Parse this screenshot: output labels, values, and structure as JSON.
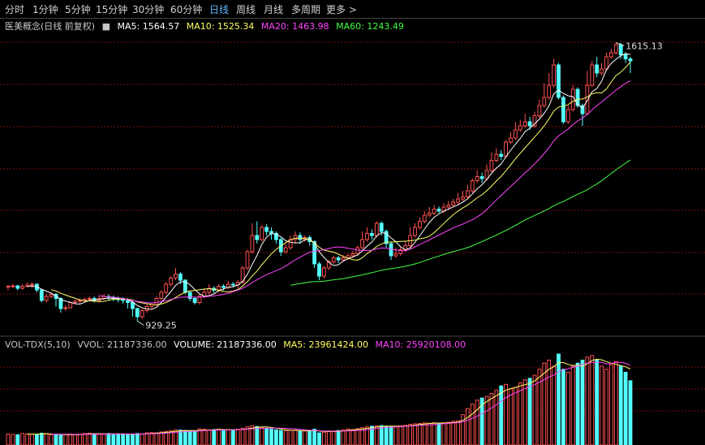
{
  "tabs": [
    "分时",
    "1分钟",
    "5分钟",
    "15分钟",
    "30分钟",
    "60分钟",
    "日线",
    "周线",
    "月线",
    "多周期",
    "更多 >"
  ],
  "active_tab": "日线",
  "header": {
    "name": "医美概念(日线 前复权)",
    "ma5": "MA5: 1564.57",
    "ma10": "MA10: 1525.34",
    "ma20": "MA20: 1463.98",
    "ma60": "MA60: 1243.49"
  },
  "vol_header": {
    "name": "VOL-TDX(5,10)",
    "vvol": "VVOL: 21187336.00",
    "volume": "VOLUME: 21187336.00",
    "ma5": "MA5: 23961424.00",
    "ma10": "MA10: 25920108.00"
  },
  "colors": {
    "up": "#ff5050",
    "down": "#54ffff",
    "ma5": "#ffffff",
    "ma10": "#ffff66",
    "ma20": "#ff44ff",
    "ma60": "#44ff44",
    "grid": "#7a1010",
    "text": "#c8c8c8",
    "active_tab": "#5fb8ff"
  },
  "chart_data": {
    "type": "candlestick",
    "annotations": {
      "high": "1615.13",
      "low": "929.25"
    },
    "price_range": [
      900,
      1640
    ],
    "volume_range": [
      0,
      30000000
    ],
    "candles": [
      [
        1013,
        1015,
        1005,
        1018
      ],
      [
        1015,
        1016,
        1010,
        1020
      ],
      [
        1016,
        1010,
        1005,
        1018
      ],
      [
        1010,
        1015,
        1006,
        1020
      ],
      [
        1015,
        1018,
        1012,
        1025
      ],
      [
        1018,
        1020,
        1010,
        1024
      ],
      [
        1020,
        1006,
        1000,
        1022
      ],
      [
        1006,
        980,
        975,
        1008
      ],
      [
        980,
        990,
        975,
        995
      ],
      [
        990,
        995,
        985,
        1000
      ],
      [
        995,
        985,
        965,
        998
      ],
      [
        985,
        960,
        950,
        988
      ],
      [
        960,
        962,
        955,
        968
      ],
      [
        962,
        975,
        960,
        978
      ],
      [
        975,
        978,
        970,
        982
      ],
      [
        978,
        980,
        973,
        985
      ],
      [
        980,
        983,
        975,
        987
      ],
      [
        983,
        985,
        978,
        990
      ],
      [
        985,
        980,
        975,
        990
      ],
      [
        980,
        985,
        975,
        992
      ],
      [
        985,
        990,
        980,
        995
      ],
      [
        990,
        988,
        980,
        995
      ],
      [
        988,
        985,
        978,
        992
      ],
      [
        985,
        982,
        975,
        990
      ],
      [
        982,
        980,
        972,
        988
      ],
      [
        980,
        975,
        960,
        985
      ],
      [
        975,
        960,
        940,
        978
      ],
      [
        960,
        940,
        929,
        962
      ],
      [
        940,
        955,
        935,
        958
      ],
      [
        955,
        965,
        950,
        970
      ],
      [
        965,
        970,
        960,
        975
      ],
      [
        970,
        985,
        965,
        990
      ],
      [
        985,
        1000,
        980,
        1005
      ],
      [
        1000,
        1020,
        995,
        1025
      ],
      [
        1020,
        1035,
        1015,
        1040
      ],
      [
        1035,
        1045,
        1030,
        1060
      ],
      [
        1045,
        1030,
        1020,
        1050
      ],
      [
        1030,
        1000,
        995,
        1032
      ],
      [
        1000,
        985,
        978,
        1002
      ],
      [
        985,
        975,
        970,
        988
      ],
      [
        975,
        990,
        970,
        995
      ],
      [
        990,
        1000,
        985,
        1010
      ],
      [
        1000,
        1010,
        995,
        1020
      ],
      [
        1010,
        1005,
        998,
        1015
      ],
      [
        1005,
        1015,
        1000,
        1020
      ],
      [
        1015,
        1012,
        1005,
        1020
      ],
      [
        1012,
        1020,
        1008,
        1028
      ],
      [
        1020,
        1018,
        1012,
        1025
      ],
      [
        1018,
        1025,
        1010,
        1030
      ],
      [
        1025,
        1060,
        1020,
        1065
      ],
      [
        1060,
        1100,
        1055,
        1105
      ],
      [
        1100,
        1140,
        1095,
        1170
      ],
      [
        1140,
        1130,
        1120,
        1175
      ],
      [
        1130,
        1160,
        1125,
        1165
      ],
      [
        1160,
        1150,
        1140,
        1168
      ],
      [
        1150,
        1145,
        1130,
        1160
      ],
      [
        1145,
        1130,
        1120,
        1150
      ],
      [
        1130,
        1100,
        1090,
        1135
      ],
      [
        1100,
        1110,
        1095,
        1120
      ],
      [
        1110,
        1130,
        1105,
        1140
      ],
      [
        1130,
        1140,
        1120,
        1150
      ],
      [
        1140,
        1130,
        1120,
        1148
      ],
      [
        1130,
        1135,
        1125,
        1140
      ],
      [
        1135,
        1125,
        1115,
        1140
      ],
      [
        1125,
        1070,
        1060,
        1128
      ],
      [
        1070,
        1040,
        1030,
        1075
      ],
      [
        1040,
        1060,
        1035,
        1065
      ],
      [
        1060,
        1075,
        1055,
        1080
      ],
      [
        1075,
        1085,
        1070,
        1090
      ],
      [
        1085,
        1080,
        1072,
        1090
      ],
      [
        1080,
        1085,
        1075,
        1092
      ],
      [
        1085,
        1090,
        1080,
        1095
      ],
      [
        1090,
        1095,
        1085,
        1102
      ],
      [
        1095,
        1110,
        1090,
        1115
      ],
      [
        1110,
        1130,
        1105,
        1150
      ],
      [
        1130,
        1145,
        1125,
        1160
      ],
      [
        1145,
        1140,
        1130,
        1155
      ],
      [
        1140,
        1170,
        1135,
        1175
      ],
      [
        1170,
        1150,
        1140,
        1175
      ],
      [
        1150,
        1120,
        1110,
        1155
      ],
      [
        1120,
        1090,
        1080,
        1125
      ],
      [
        1090,
        1095,
        1085,
        1110
      ],
      [
        1095,
        1105,
        1090,
        1112
      ],
      [
        1105,
        1115,
        1100,
        1125
      ],
      [
        1115,
        1140,
        1110,
        1160
      ],
      [
        1140,
        1160,
        1135,
        1170
      ],
      [
        1160,
        1175,
        1155,
        1185
      ],
      [
        1175,
        1190,
        1170,
        1200
      ],
      [
        1190,
        1195,
        1185,
        1210
      ],
      [
        1195,
        1205,
        1190,
        1215
      ],
      [
        1205,
        1200,
        1195,
        1212
      ],
      [
        1200,
        1210,
        1195,
        1220
      ],
      [
        1210,
        1215,
        1205,
        1225
      ],
      [
        1215,
        1222,
        1210,
        1230
      ],
      [
        1222,
        1230,
        1215,
        1245
      ],
      [
        1230,
        1235,
        1225,
        1250
      ],
      [
        1235,
        1250,
        1230,
        1265
      ],
      [
        1250,
        1275,
        1245,
        1280
      ],
      [
        1275,
        1285,
        1270,
        1300
      ],
      [
        1285,
        1280,
        1270,
        1295
      ],
      [
        1280,
        1300,
        1275,
        1315
      ],
      [
        1300,
        1325,
        1295,
        1345
      ],
      [
        1325,
        1340,
        1320,
        1355
      ],
      [
        1340,
        1335,
        1325,
        1350
      ],
      [
        1335,
        1370,
        1330,
        1375
      ],
      [
        1370,
        1380,
        1365,
        1395
      ],
      [
        1380,
        1400,
        1375,
        1420
      ],
      [
        1400,
        1410,
        1395,
        1425
      ],
      [
        1410,
        1420,
        1405,
        1440
      ],
      [
        1420,
        1410,
        1400,
        1432
      ],
      [
        1410,
        1435,
        1405,
        1445
      ],
      [
        1435,
        1460,
        1430,
        1475
      ],
      [
        1460,
        1480,
        1455,
        1515
      ],
      [
        1480,
        1510,
        1475,
        1540
      ],
      [
        1510,
        1560,
        1505,
        1575
      ],
      [
        1560,
        1480,
        1475,
        1565
      ],
      [
        1480,
        1420,
        1415,
        1485
      ],
      [
        1420,
        1450,
        1415,
        1460
      ],
      [
        1450,
        1500,
        1445,
        1510
      ],
      [
        1500,
        1460,
        1455,
        1505
      ],
      [
        1460,
        1440,
        1410,
        1465
      ],
      [
        1440,
        1510,
        1435,
        1545
      ],
      [
        1510,
        1560,
        1505,
        1570
      ],
      [
        1560,
        1540,
        1530,
        1580
      ],
      [
        1540,
        1550,
        1535,
        1565
      ],
      [
        1550,
        1580,
        1545,
        1590
      ],
      [
        1580,
        1590,
        1575,
        1600
      ],
      [
        1590,
        1610,
        1585,
        1615
      ],
      [
        1610,
        1585,
        1575,
        1615
      ],
      [
        1585,
        1575,
        1565,
        1592
      ],
      [
        1575,
        1570,
        1540,
        1580
      ]
    ],
    "volume": [
      3.6,
      3.5,
      3.4,
      3.8,
      3.7,
      3.6,
      3.5,
      3.9,
      3.8,
      3.4,
      3.3,
      3.2,
      3.5,
      3.6,
      3.4,
      3.6,
      3.8,
      3.9,
      3.7,
      3.6,
      3.5,
      3.8,
      3.6,
      3.7,
      3.5,
      3.4,
      3.6,
      3.8,
      3.7,
      4.0,
      4.1,
      4.0,
      4.3,
      4.5,
      4.7,
      5.0,
      4.9,
      4.8,
      4.6,
      4.5,
      5.3,
      5.2,
      5.0,
      5.1,
      5.2,
      5.0,
      5.1,
      4.9,
      5.2,
      5.5,
      6.0,
      6.3,
      6.1,
      5.8,
      5.5,
      5.2,
      5.0,
      4.8,
      4.7,
      4.8,
      4.9,
      4.7,
      4.6,
      4.5,
      5.2,
      4.0,
      4.2,
      4.4,
      4.6,
      4.8,
      5.0,
      5.3,
      5.1,
      5.4,
      5.7,
      6.0,
      6.2,
      6.3,
      6.4,
      6.2,
      6.0,
      6.1,
      6.3,
      6.5,
      6.8,
      7.0,
      7.1,
      7.3,
      7.2,
      7.4,
      7.1,
      7.3,
      7.5,
      7.8,
      8.0,
      10.0,
      12.0,
      13.5,
      14.8,
      15.5,
      16.0,
      17.0,
      18.0,
      19.5,
      20.0,
      18.5,
      19.0,
      20.5,
      21.5,
      22.0,
      23.0,
      25.0,
      27.0,
      28.0,
      26.0,
      30.0,
      25.0,
      24.0,
      26.0,
      27.0,
      28.0,
      29.0,
      29.5,
      28.0,
      26.0,
      25.0,
      26.5,
      27.5,
      26.0,
      24.0,
      21.2
    ]
  }
}
